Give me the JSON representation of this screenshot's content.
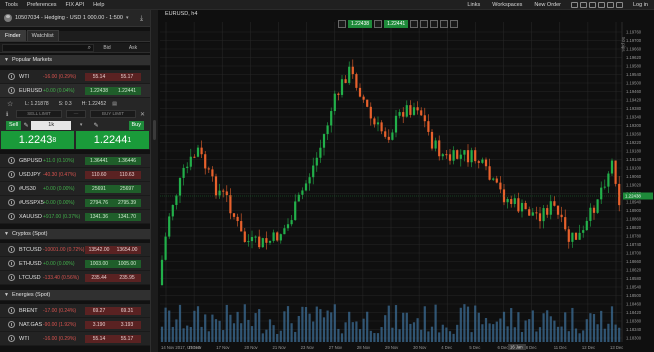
{
  "menu": {
    "left": [
      "Tools",
      "Preferences",
      "FIX API",
      "Help"
    ],
    "right": [
      "Links",
      "Workspaces",
      "New Order",
      "Log in"
    ]
  },
  "account": {
    "label": "10507034 - Hedging - USD 1 000.00 - 1:500"
  },
  "tabs": [
    "Finder",
    "Watchlist"
  ],
  "list_header": {
    "bid": "Bid",
    "ask": "Ask"
  },
  "sections": {
    "popular": "Popular Markets",
    "crypto": "Cryptos (Spot)",
    "energies": "Energies (Spot)"
  },
  "rows": [
    {
      "sym": "WTI",
      "chg": "-16.00 (0.29%)",
      "bid": "55.14",
      "ask": "55.17",
      "dir": "dn"
    },
    {
      "sym": "EURUSD",
      "chg": "+0.00 (0.04%)",
      "bid": "1.22438",
      "ask": "1.22441",
      "dir": "up"
    },
    {
      "sym": "GBPUSD",
      "chg": "+11.0 (0.10%)",
      "bid": "1.36441",
      "ask": "1.36446",
      "dir": "up"
    },
    {
      "sym": "USDJPY",
      "chg": "-40.30 (0.47%)",
      "bid": "110.60",
      "ask": "110.63",
      "dir": "dn"
    },
    {
      "sym": "#US30",
      "chg": "+0.00 (0.00%)",
      "bid": "25691",
      "ask": "25697",
      "dir": "up"
    },
    {
      "sym": "#USSPX5",
      "chg": "+0.00 (0.00%)",
      "bid": "2794.76",
      "ask": "2795.39",
      "dir": "up"
    },
    {
      "sym": "XAUUSD",
      "chg": "+917.00 (0.37%)",
      "bid": "1341.36",
      "ask": "1341.70",
      "dir": "up"
    },
    {
      "sym": "BTCUSD",
      "chg": "-10001.00 (0.72%)",
      "bid": "13542.00",
      "ask": "13654.00",
      "dir": "dn"
    },
    {
      "sym": "ETHUSD",
      "chg": "+0.00 (0.00%)",
      "bid": "1003.00",
      "ask": "1005.00",
      "dir": "up"
    },
    {
      "sym": "LTCUSD",
      "chg": "-133.40 (0.56%)",
      "bid": "235.44",
      "ask": "235.95",
      "dir": "dn"
    },
    {
      "sym": "BRENT",
      "chg": "-17.00 (0.24%)",
      "bid": "69.27",
      "ask": "69.31",
      "dir": "dn"
    },
    {
      "sym": "NAT.GAS",
      "chg": "-90.00 (1.92%)",
      "bid": "3.190",
      "ask": "3.193",
      "dir": "dn"
    },
    {
      "sym": "WTI",
      "chg": "-16.00 (0.29%)",
      "bid": "55.14",
      "ask": "55.17",
      "dir": "dn"
    }
  ],
  "ticket": {
    "ohl": {
      "l": "L: 1.21878",
      "s": "S: 0.3",
      "h": "H: 1.22452"
    },
    "sell_limit": "SELL LIMIT",
    "buy_limit": "BUY LIMIT",
    "sell": "Sell",
    "buy": "Buy",
    "qty": "1k",
    "sell_price_main": "1.2243",
    "sell_price_pip": "8",
    "buy_price_main": "1.2244",
    "buy_price_pip": "1"
  },
  "chart": {
    "title": "EURUSD, h4",
    "sell_btn": "1.22438",
    "buy_btn": "1.22441",
    "zoom": "50 pips",
    "date_bar": "16 Jan",
    "x_labels": [
      "14 Nov 2017, UTC+0",
      "15 Nov",
      "17 Nov",
      "20 Nov",
      "21 Nov",
      "23 Nov",
      "27 Nov",
      "28 Nov",
      "29 Nov",
      "30 Nov",
      "4 Dec",
      "5 Dec",
      "6 Dec",
      "8 Dec",
      "11 Dec",
      "12 Dec",
      "13 Dec"
    ],
    "y_labels": [
      "1.19760",
      "1.19700",
      "1.19660",
      "1.19620",
      "1.19580",
      "1.19540",
      "1.19500",
      "1.19460",
      "1.19420",
      "1.19380",
      "1.19340",
      "1.19300",
      "1.19260",
      "1.19220",
      "1.19180",
      "1.19140",
      "1.19100",
      "1.19060",
      "1.19020",
      "1.18980",
      "1.18940",
      "1.18900",
      "1.18860",
      "1.18820",
      "1.18780",
      "1.18740",
      "1.18700",
      "1.18660",
      "1.18620",
      "1.18580",
      "1.18540",
      "1.18500",
      "1.18460",
      "1.18420",
      "1.18380",
      "1.18340",
      "1.18300"
    ],
    "current_price": "1.22438",
    "colors": {
      "up": "#22b04a",
      "down": "#e8612c",
      "volume": "#3c6e96",
      "grid": "#262626"
    }
  }
}
